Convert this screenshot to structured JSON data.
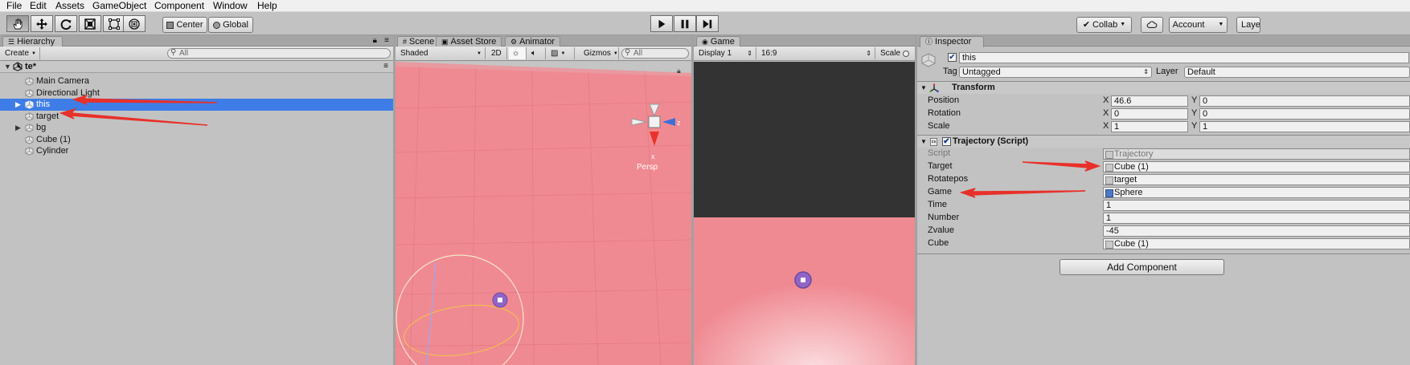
{
  "menu": [
    "File",
    "Edit",
    "Assets",
    "GameObject",
    "Component",
    "Window",
    "Help"
  ],
  "toolbar": {
    "tools": [
      "hand-tool",
      "move-tool",
      "rotate-tool",
      "scale-tool",
      "rect-tool"
    ],
    "pivot": "Center",
    "space": "Global",
    "collab": "Collab",
    "account": "Account",
    "layers": "Layers"
  },
  "hierarchy": {
    "tab": "Hierarchy",
    "create": "Create",
    "search_placeholder": "All",
    "scene": "te*",
    "items": [
      {
        "label": "Main Camera",
        "expandable": false,
        "selected": false
      },
      {
        "label": "Directional Light",
        "expandable": false,
        "selected": false
      },
      {
        "label": "this",
        "expandable": true,
        "selected": true
      },
      {
        "label": "target",
        "expandable": false,
        "selected": false
      },
      {
        "label": "bg",
        "expandable": true,
        "selected": false
      },
      {
        "label": "Cube (1)",
        "expandable": false,
        "selected": false
      },
      {
        "label": "Cylinder",
        "expandable": false,
        "selected": false
      }
    ]
  },
  "scene": {
    "tabs": [
      "Scene",
      "Asset Store",
      "Animator"
    ],
    "shading": "Shaded",
    "mode2d": "2D",
    "gizmos": "Gizmos",
    "search_placeholder": "All",
    "persp": "Persp"
  },
  "game": {
    "tab": "Game",
    "display": "Display 1",
    "aspect": "16:9",
    "scale": "Scale"
  },
  "inspector": {
    "tab": "Inspector",
    "object_name": "this",
    "tag_label": "Tag",
    "tag_value": "Untagged",
    "layer_label": "Layer",
    "layer_value": "Default",
    "transform": {
      "title": "Transform",
      "rows": [
        {
          "label": "Position",
          "x": "46.6",
          "y": "0"
        },
        {
          "label": "Rotation",
          "x": "0",
          "y": "0"
        },
        {
          "label": "Scale",
          "x": "1",
          "y": "1"
        }
      ]
    },
    "script": {
      "title": "Trajectory (Script)",
      "rows": [
        {
          "label": "Script",
          "value": "Trajectory",
          "kind": "script"
        },
        {
          "label": "Target",
          "value": "Cube (1)",
          "kind": "obj"
        },
        {
          "label": "Rotatepos",
          "value": "target",
          "kind": "obj"
        },
        {
          "label": "Game",
          "value": "Sphere",
          "kind": "objblue"
        },
        {
          "label": "Time",
          "value": "1",
          "kind": "num"
        },
        {
          "label": "Number",
          "value": "1",
          "kind": "num"
        },
        {
          "label": "Zvalue",
          "value": "-45",
          "kind": "num"
        },
        {
          "label": "Cube",
          "value": "Cube (1)",
          "kind": "obj"
        }
      ]
    },
    "add_component": "Add Component"
  },
  "colors": {
    "scene_bg": "#f08a92",
    "selection": "#3e7de7",
    "annotation_arrow": "#e8302a"
  }
}
